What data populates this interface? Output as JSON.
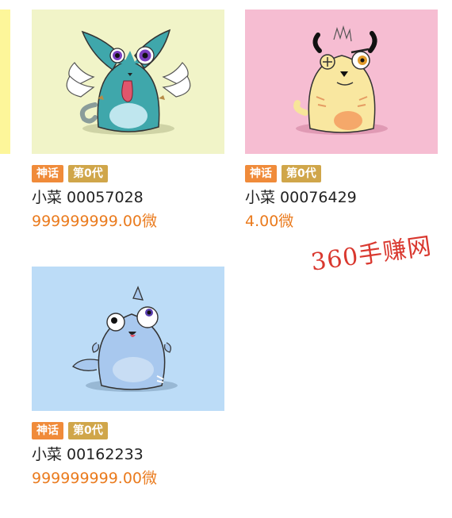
{
  "colors": {
    "tag_myth": "#f08b3a",
    "tag_generation": "#d0a64a",
    "price": "#ea7b1e",
    "watermark": "#d9382f"
  },
  "cards": [
    {
      "background": "#f1f4c8",
      "tags": [
        "神话",
        "第0代"
      ],
      "name": "小菜 00057028",
      "price": "999999999.00微",
      "icon": "teal-winged-cat-image"
    },
    {
      "background": "#f6bdd2",
      "tags": [
        "神话",
        "第0代"
      ],
      "name": "小菜 00076429",
      "price": "4.00微",
      "icon": "yellow-eyepatch-cat-image"
    },
    {
      "background": "#bcdcf7",
      "tags": [
        "神话",
        "第0代"
      ],
      "name": "小菜 00162233",
      "price": "999999999.00微",
      "icon": "blue-fin-cat-image"
    }
  ],
  "watermark": "360手赚网"
}
